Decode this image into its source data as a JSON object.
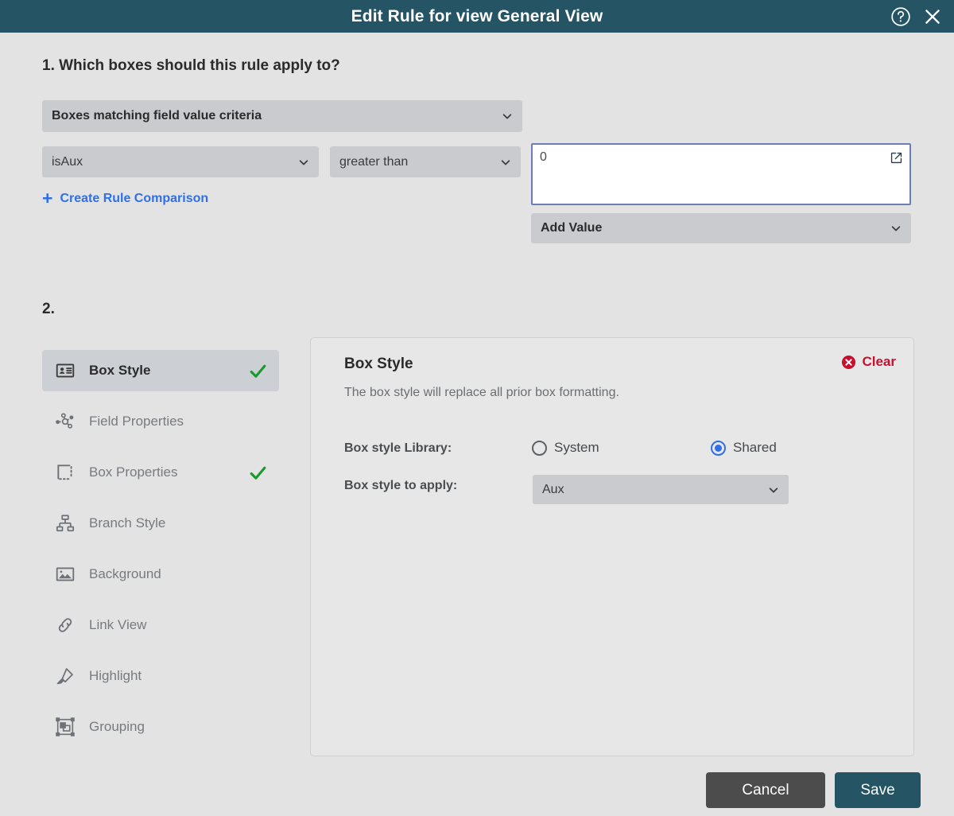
{
  "titlebar": {
    "title": "Edit Rule for view General View",
    "help_icon": "help-circle-icon",
    "close_icon": "close-icon",
    "background": "#255464"
  },
  "section1": {
    "heading": "1. Which boxes should this rule apply to?",
    "scope_select": {
      "value": "Boxes matching field value criteria"
    },
    "field_select": {
      "value": "isAux"
    },
    "operator_select": {
      "value": "greater than"
    },
    "value_input": {
      "value": "0",
      "popout_icon": "external-link-icon"
    },
    "add_value_select": {
      "value": "Add Value"
    },
    "create_comparison": {
      "plus": "+",
      "label": "Create Rule Comparison",
      "color": "#2f6fe8"
    }
  },
  "section2": {
    "heading": "2.",
    "nav_items": [
      {
        "label": "Box Style",
        "icon": "id-card-icon",
        "active": true,
        "checked": true
      },
      {
        "label": "Field Properties",
        "icon": "node-graph-icon",
        "active": false,
        "checked": false
      },
      {
        "label": "Box Properties",
        "icon": "dashed-box-icon",
        "active": false,
        "checked": true
      },
      {
        "label": "Branch Style",
        "icon": "hierarchy-icon",
        "active": false,
        "checked": false
      },
      {
        "label": "Background",
        "icon": "image-icon",
        "active": false,
        "checked": false
      },
      {
        "label": "Link View",
        "icon": "link-icon",
        "active": false,
        "checked": false
      },
      {
        "label": "Highlight",
        "icon": "highlighter-icon",
        "active": false,
        "checked": false
      },
      {
        "label": "Grouping",
        "icon": "group-shapes-icon",
        "active": false,
        "checked": false
      }
    ],
    "panel": {
      "title": "Box Style",
      "subtitle": "The box style will replace all prior box formatting.",
      "clear_label": "Clear",
      "clear_icon": "error-circle-icon",
      "clear_color": "#c8102e",
      "library_label": "Box style Library:",
      "library_options": [
        {
          "label": "System",
          "selected": false
        },
        {
          "label": "Shared",
          "selected": true
        }
      ],
      "apply_label": "Box style to apply:",
      "apply_select": {
        "value": "Aux"
      }
    }
  },
  "footer": {
    "cancel_label": "Cancel",
    "save_label": "Save",
    "save_color": "#255464",
    "cancel_color": "#4c4c4c"
  },
  "checkmark_color": "#1a9a2e"
}
